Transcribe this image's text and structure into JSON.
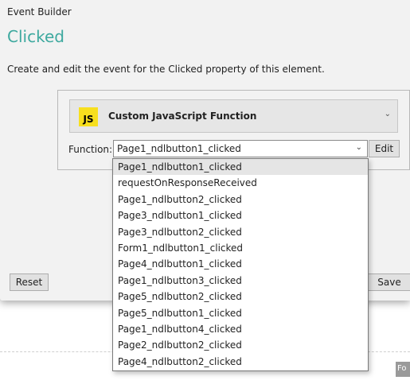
{
  "dialog": {
    "title": "Event Builder",
    "header": "Clicked",
    "description": "Create and edit the event for the Clicked property of this element.",
    "event_type": {
      "badge": "JS",
      "label": "Custom JavaScript Function",
      "chevron": "⌄"
    },
    "function": {
      "label": "Function:",
      "value": "Page1_ndlbutton1_clicked",
      "chevron": "⌄",
      "edit_label": "Edit"
    },
    "reset_label": "Reset",
    "save_label": "Save"
  },
  "dropdown": {
    "selected_index": 0,
    "options": [
      "Page1_ndlbutton1_clicked",
      "requestOnResponseReceived",
      "Page1_ndlbutton2_clicked",
      "Page3_ndlbutton1_clicked",
      "Page3_ndlbutton2_clicked",
      "Form1_ndlbutton1_clicked",
      "Page4_ndlbutton1_clicked",
      "Page1_ndlbutton3_clicked",
      "Page5_ndlbutton2_clicked",
      "Page5_ndlbutton1_clicked",
      "Page1_ndlbutton4_clicked",
      "Page2_ndlbutton2_clicked",
      "Page4_ndlbutton2_clicked"
    ]
  },
  "background": {
    "tab_label": "Fo"
  },
  "colors": {
    "header": "#3ea99f",
    "js_badge": "#f7df1e",
    "dialog_bg": "#f2f2f2"
  }
}
